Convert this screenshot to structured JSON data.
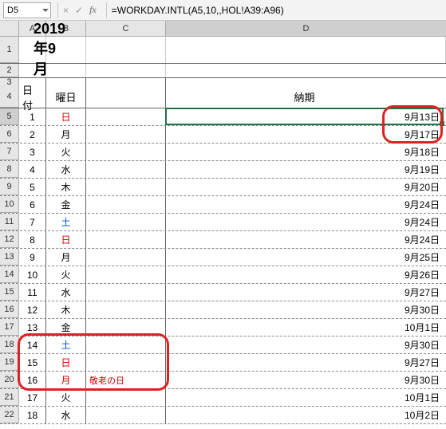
{
  "namebox": "D5",
  "formula": "=WORKDAY.INTL(A5,10,,HOL!A39:A96)",
  "cols": [
    "A",
    "B",
    "C",
    "D"
  ],
  "title": "2019年9月",
  "headers": {
    "a": "日付",
    "b": "曜日",
    "d": "納期"
  },
  "rows": [
    {
      "r": 5,
      "a": "1",
      "b": "日",
      "bcls": "red",
      "c": "",
      "d": "9月13日"
    },
    {
      "r": 6,
      "a": "2",
      "b": "月",
      "bcls": "",
      "c": "",
      "d": "9月17日"
    },
    {
      "r": 7,
      "a": "3",
      "b": "火",
      "bcls": "",
      "c": "",
      "d": "9月18日"
    },
    {
      "r": 8,
      "a": "4",
      "b": "水",
      "bcls": "",
      "c": "",
      "d": "9月19日"
    },
    {
      "r": 9,
      "a": "5",
      "b": "木",
      "bcls": "",
      "c": "",
      "d": "9月20日"
    },
    {
      "r": 10,
      "a": "6",
      "b": "金",
      "bcls": "",
      "c": "",
      "d": "9月24日"
    },
    {
      "r": 11,
      "a": "7",
      "b": "土",
      "bcls": "blue",
      "c": "",
      "d": "9月24日"
    },
    {
      "r": 12,
      "a": "8",
      "b": "日",
      "bcls": "red",
      "c": "",
      "d": "9月24日"
    },
    {
      "r": 13,
      "a": "9",
      "b": "月",
      "bcls": "",
      "c": "",
      "d": "9月25日"
    },
    {
      "r": 14,
      "a": "10",
      "b": "火",
      "bcls": "",
      "c": "",
      "d": "9月26日"
    },
    {
      "r": 15,
      "a": "11",
      "b": "水",
      "bcls": "",
      "c": "",
      "d": "9月27日"
    },
    {
      "r": 16,
      "a": "12",
      "b": "木",
      "bcls": "",
      "c": "",
      "d": "9月30日"
    },
    {
      "r": 17,
      "a": "13",
      "b": "金",
      "bcls": "",
      "c": "",
      "d": "10月1日"
    },
    {
      "r": 18,
      "a": "14",
      "b": "土",
      "bcls": "blue",
      "c": "",
      "d": "9月30日"
    },
    {
      "r": 19,
      "a": "15",
      "b": "日",
      "bcls": "red",
      "c": "",
      "d": "9月27日"
    },
    {
      "r": 20,
      "a": "16",
      "b": "月",
      "bcls": "red",
      "c": "敬老の日",
      "ccls": "red",
      "d": "9月30日"
    },
    {
      "r": 21,
      "a": "17",
      "b": "火",
      "bcls": "",
      "c": "",
      "d": "10月1日"
    },
    {
      "r": 22,
      "a": "18",
      "b": "水",
      "bcls": "",
      "c": "",
      "d": "10月2日"
    }
  ]
}
